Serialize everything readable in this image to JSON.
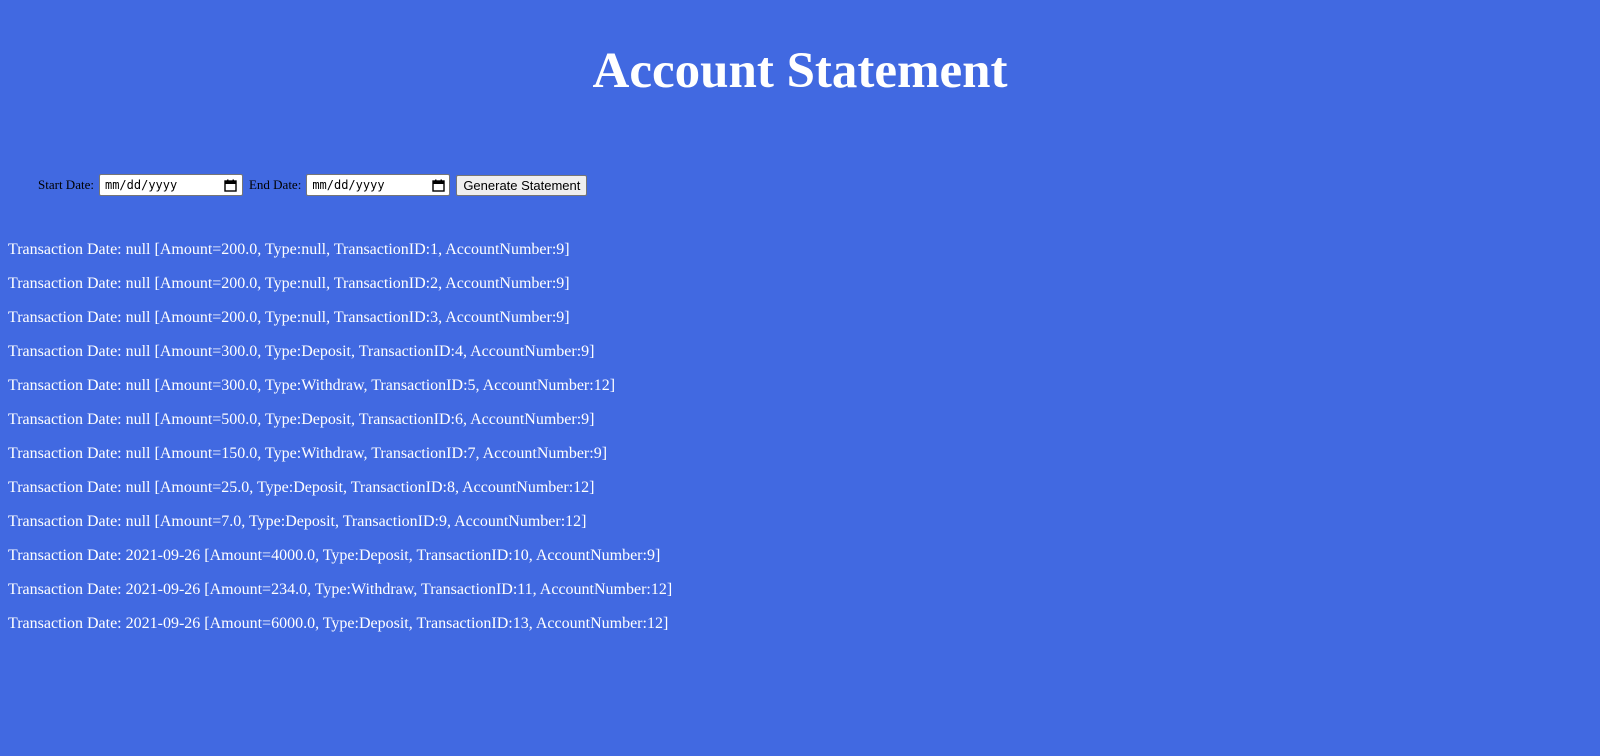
{
  "page": {
    "title": "Account Statement"
  },
  "colors": {
    "background": "#4169e1",
    "text": "#ffffff"
  },
  "form": {
    "start_label": "Start Date:",
    "start_value": "mm/dd/yyyy",
    "end_label": "End Date:",
    "end_value": "mm/dd/yyyy",
    "calendar_icon": "calendar-icon",
    "submit_label": "Generate Statement"
  },
  "transactions": [
    "Transaction Date: null [Amount=200.0, Type:null, TransactionID:1, AccountNumber:9]",
    "Transaction Date: null [Amount=200.0, Type:null, TransactionID:2, AccountNumber:9]",
    "Transaction Date: null [Amount=200.0, Type:null, TransactionID:3, AccountNumber:9]",
    "Transaction Date: null [Amount=300.0, Type:Deposit, TransactionID:4, AccountNumber:9]",
    "Transaction Date: null [Amount=300.0, Type:Withdraw, TransactionID:5, AccountNumber:12]",
    "Transaction Date: null [Amount=500.0, Type:Deposit, TransactionID:6, AccountNumber:9]",
    "Transaction Date: null [Amount=150.0, Type:Withdraw, TransactionID:7, AccountNumber:9]",
    "Transaction Date: null [Amount=25.0, Type:Deposit, TransactionID:8, AccountNumber:12]",
    "Transaction Date: null [Amount=7.0, Type:Deposit, TransactionID:9, AccountNumber:12]",
    "Transaction Date: 2021-09-26 [Amount=4000.0, Type:Deposit, TransactionID:10, AccountNumber:9]",
    "Transaction Date: 2021-09-26 [Amount=234.0, Type:Withdraw, TransactionID:11, AccountNumber:12]",
    "Transaction Date: 2021-09-26 [Amount=6000.0, Type:Deposit, TransactionID:13, AccountNumber:12]"
  ]
}
